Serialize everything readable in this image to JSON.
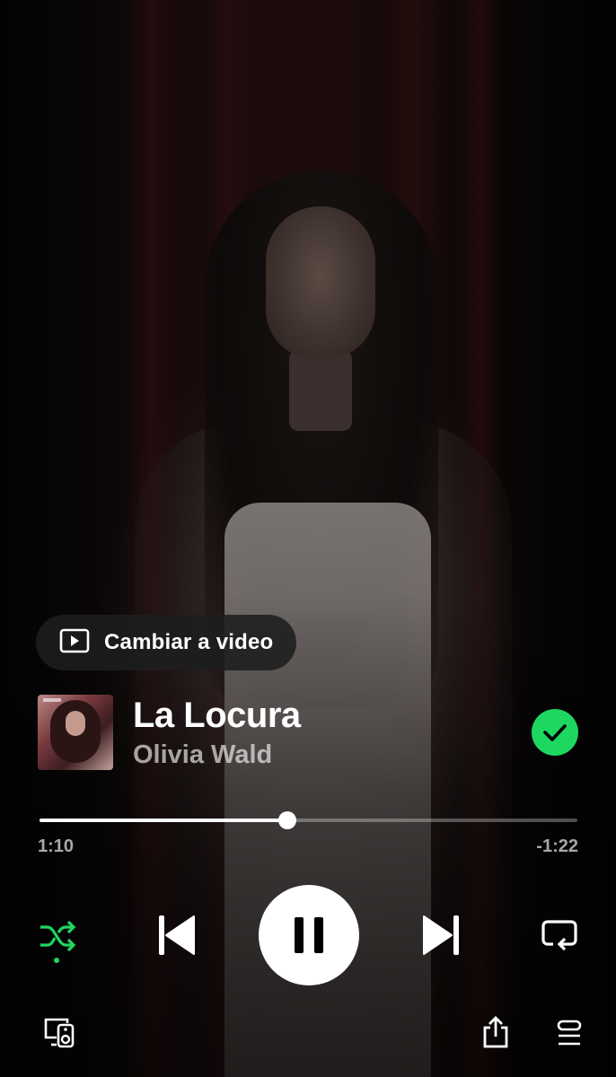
{
  "video_toggle": {
    "label": "Cambiar a video",
    "icon": "video-icon"
  },
  "track": {
    "title": "La Locura",
    "artist": "Olivia Wald",
    "saved": true
  },
  "playback": {
    "elapsed": "1:10",
    "remaining": "-1:22",
    "progress": 0.46,
    "state": "playing",
    "shuffle": true,
    "repeat": false
  },
  "controls": {
    "shuffle_icon": "shuffle-icon",
    "previous_icon": "skip-previous-icon",
    "pause_icon": "pause-icon",
    "next_icon": "skip-next-icon",
    "repeat_icon": "repeat-icon"
  },
  "bottom_bar": {
    "devices_icon": "connect-device-icon",
    "share_icon": "share-icon",
    "queue_icon": "queue-icon"
  },
  "colors": {
    "accent": "#1ed760",
    "text_primary": "#ffffff",
    "text_secondary": "#9e9e9e"
  }
}
